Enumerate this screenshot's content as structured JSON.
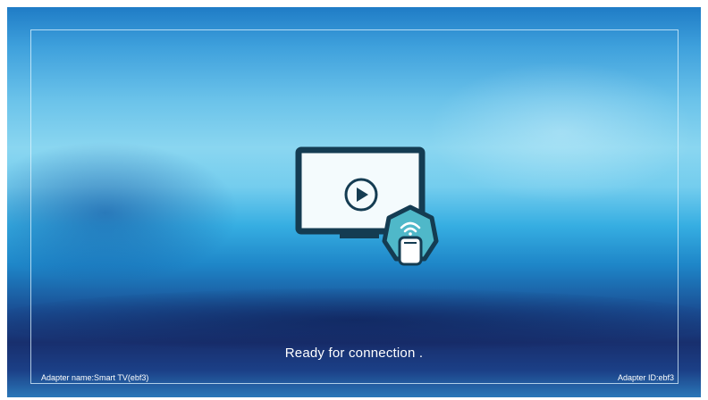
{
  "screen": {
    "status": "Ready for connection .",
    "adapter_name": "Adapter name:Smart TV(ebf3)",
    "adapter_id": "Adapter ID:ebf3"
  },
  "icons": {
    "tv": "tv-icon",
    "play": "play-icon",
    "badge": "wifi-remote-badge-icon",
    "wifi": "wifi-icon",
    "remote": "remote-icon"
  },
  "colors": {
    "accent_outline": "#123a52",
    "badge_fill": "#4fb8c9",
    "text": "#ffffff"
  }
}
